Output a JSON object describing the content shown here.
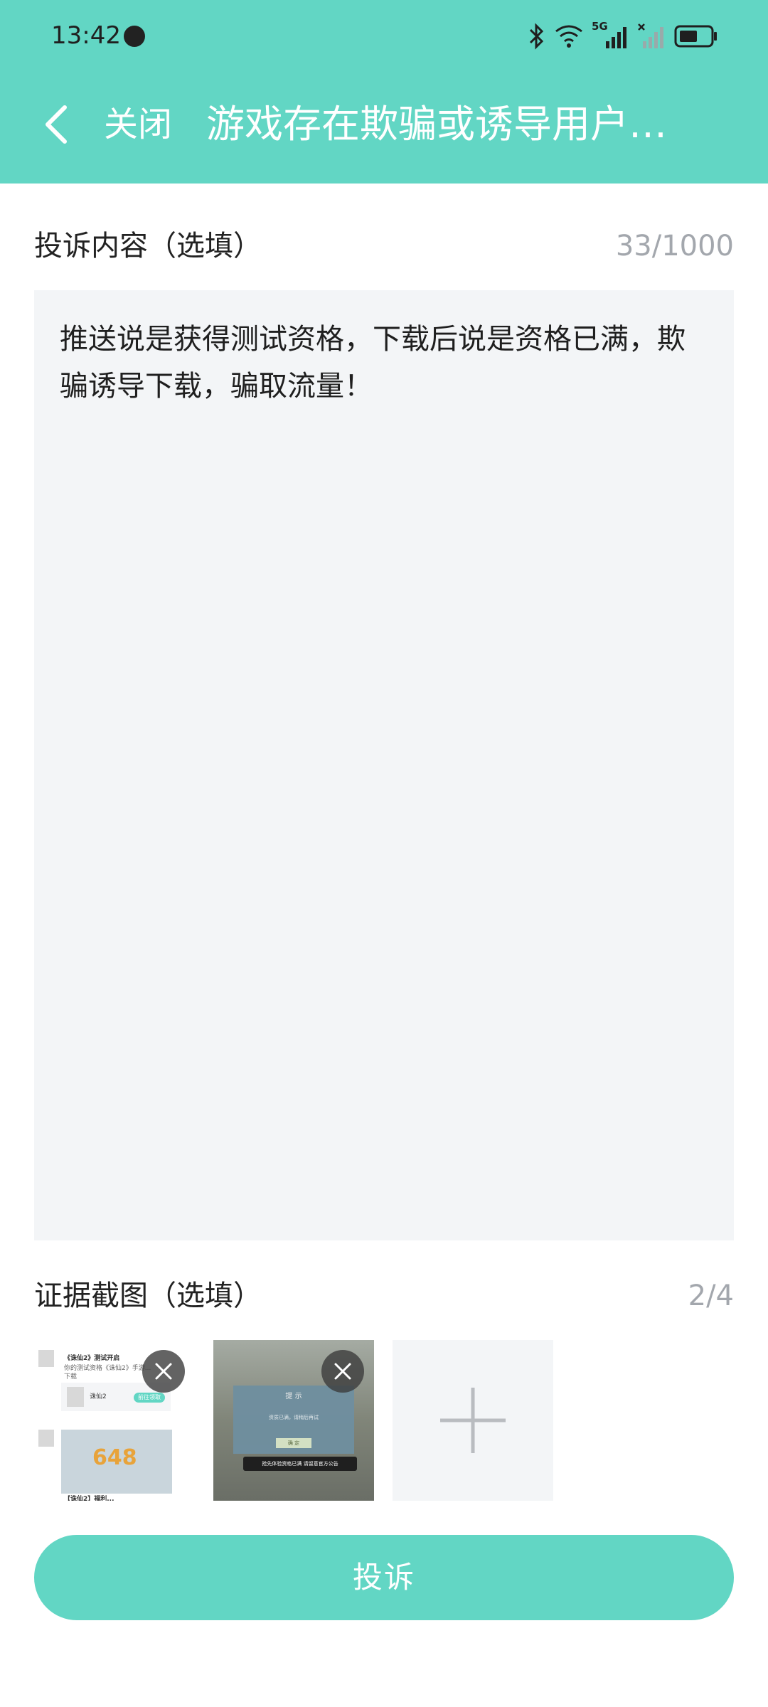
{
  "status_bar": {
    "time": "13:42",
    "network": "5G"
  },
  "nav": {
    "close_label": "关闭",
    "title": "游戏存在欺骗或诱导用户…"
  },
  "content_section": {
    "label": "投诉内容（选填）",
    "count": "33/1000",
    "text": "推送说是获得测试资格，下载后说是资格已满，欺骗诱导下载，骗取流量！"
  },
  "evidence_section": {
    "label": "证据截图（选填）",
    "count": "2/4",
    "shots": [
      {
        "heading": "《诛仙2》测试开启",
        "sub": "你的测试资格《诛仙2》手游...",
        "sub2": "下载",
        "game_name": "诛仙2",
        "pill": "前往领取",
        "banner_number": "648",
        "caption": "【诛仙2】福利..."
      },
      {
        "dialog_title": "提 示",
        "dialog_message": "资质已满，请稍后再试",
        "dialog_ok": "确 定",
        "toast": "抢先体验资格已满 请留意官方公告"
      }
    ]
  },
  "submit": {
    "label": "投诉"
  },
  "colors": {
    "accent": "#62d6c4",
    "input_bg": "#f3f5f7",
    "muted_text": "#a3a7ad"
  }
}
